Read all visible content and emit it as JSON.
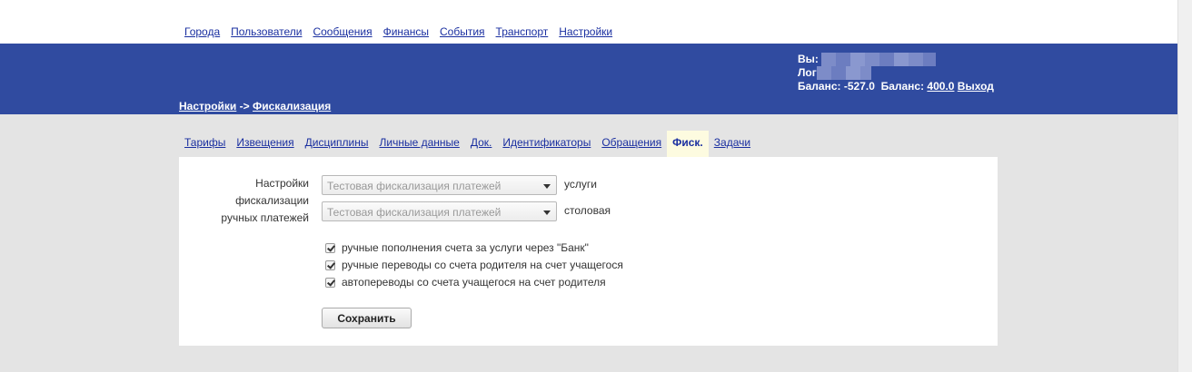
{
  "top_nav": [
    "Города",
    "Пользователи",
    "Сообщения",
    "Финансы",
    "События",
    "Транспорт",
    "Настройки"
  ],
  "breadcrumb": {
    "parent": "Настройки",
    "separator": "->",
    "current": "Фискализация"
  },
  "user": {
    "you_label": "Вы:",
    "login_label": "Лог",
    "balance_label_1": "Баланс:",
    "balance_value_1": "-527.0",
    "balance_label_2": "Баланс:",
    "balance_value_2": "400.0",
    "logout": "Выход"
  },
  "tabs": [
    "Тарифы",
    "Извещения",
    "Дисциплины",
    "Личные данные",
    "Док.",
    "Идентификаторы",
    "Обращения",
    "Фиск.",
    "Задачи"
  ],
  "active_tab": "Фиск.",
  "form": {
    "label": [
      "Настройки",
      "фискализации",
      "ручных платежей"
    ],
    "selects": [
      {
        "value": "Тестовая фискализация платежей",
        "note": "услуги"
      },
      {
        "value": "Тестовая фискализация платежей",
        "note": "столовая"
      }
    ],
    "checkboxes": [
      {
        "label": "ручные пополнения счета за услуги через \"Банк\"",
        "checked": true
      },
      {
        "label": "ручные переводы со счета родителя на счет учащегося",
        "checked": true
      },
      {
        "label": "автопереводы со счета учащегося на счет родителя",
        "checked": true
      }
    ],
    "save_label": "Сохранить"
  },
  "colors": {
    "banner": "#304ba0",
    "link": "#1a2fa0",
    "background": "#e4e4e4",
    "active_tab": "#fdfbe0"
  }
}
